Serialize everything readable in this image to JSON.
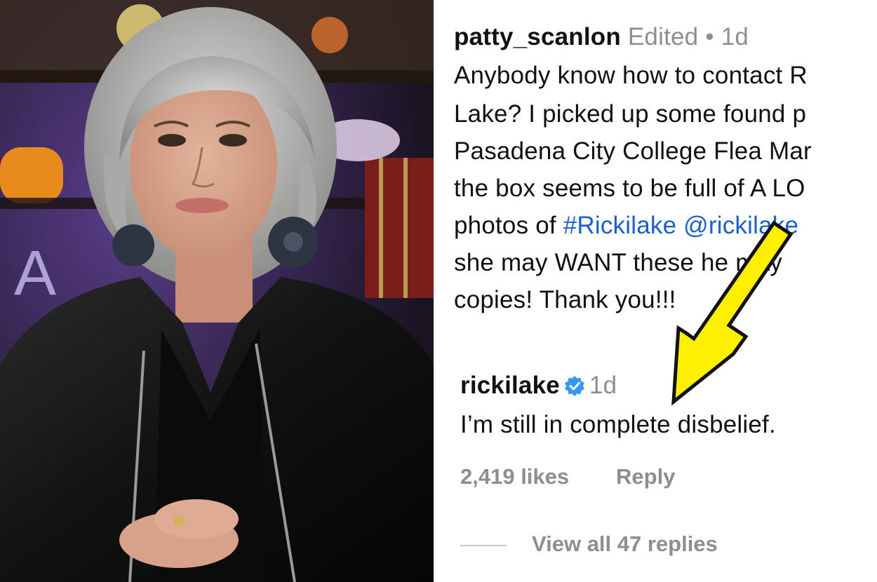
{
  "post_comment": {
    "username": "patty_scanlon",
    "edited_label": "Edited",
    "separator": "•",
    "time": "1d",
    "line1": "Anybody know how to contact R",
    "line2": "Lake? I picked up some found p",
    "line3": "Pasadena City College Flea Mar",
    "line4": "the box seems to be full of A LO",
    "line5_prefix": "photos of ",
    "hashtag": "#Rickilake",
    "mention": "@rickilake",
    "line6": "she may WANT these  he may",
    "line7": "copies! Thank you!!!"
  },
  "reply_comment": {
    "username": "rickilake",
    "verified_icon": "verified-badge-icon",
    "time": "1d",
    "text": "I’m still in complete disbelief.",
    "likes": "2,419 likes",
    "reply_label": "Reply",
    "view_replies": "View all 47 replies"
  },
  "colors": {
    "link": "#1d5fc8",
    "meta_gray": "#8e8e8e",
    "verified_blue": "#3897f0",
    "arrow_yellow": "#ffef00"
  },
  "icons": [
    "verified-badge-icon",
    "yellow-arrow-icon"
  ]
}
